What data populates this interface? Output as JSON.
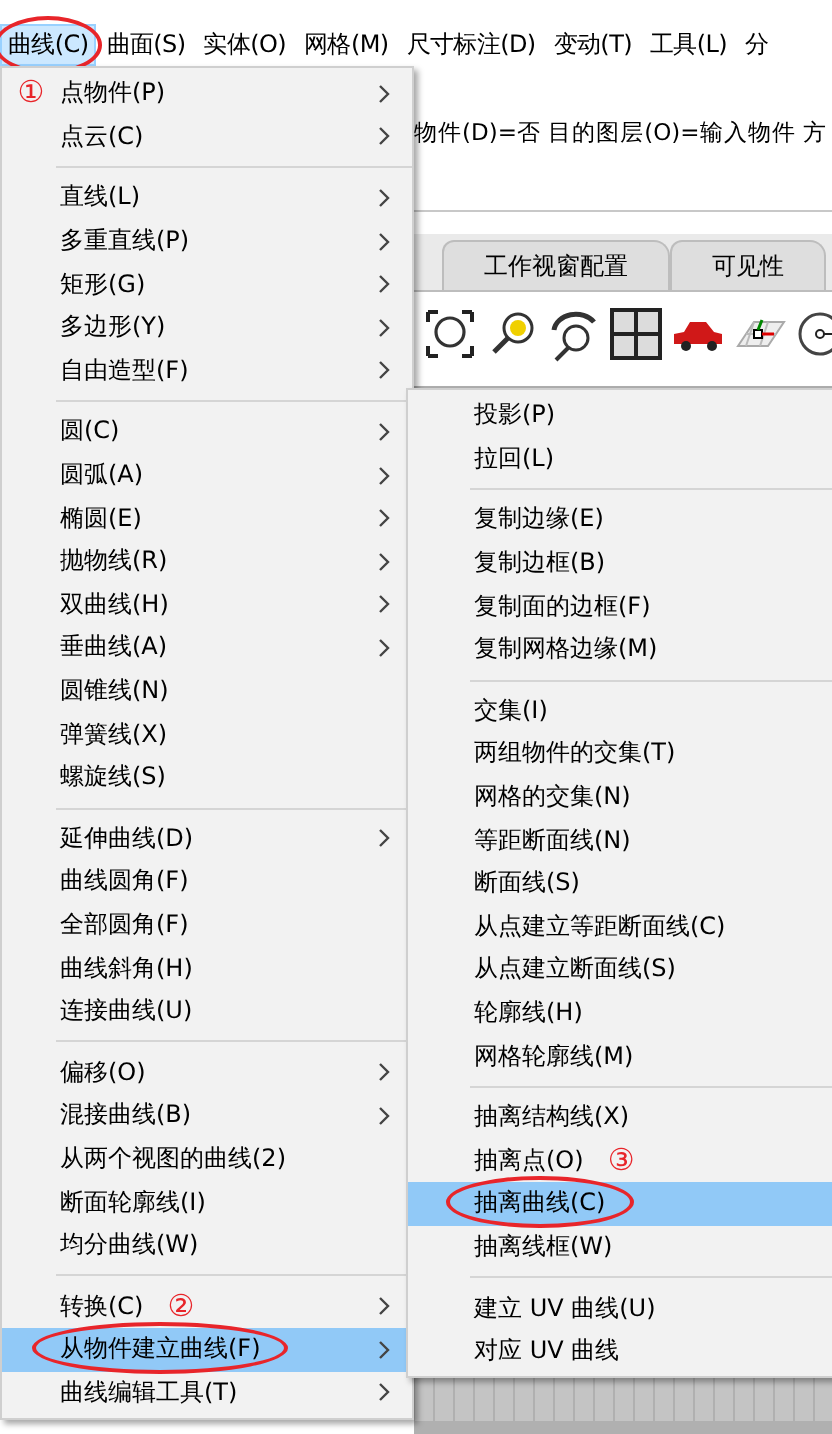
{
  "menubar": [
    {
      "label": "曲线(C)",
      "selected": true,
      "circled": true
    },
    {
      "label": "曲面(S)",
      "selected": false,
      "circled": false
    },
    {
      "label": "实体(O)",
      "selected": false,
      "circled": false
    },
    {
      "label": "网格(M)",
      "selected": false,
      "circled": false
    },
    {
      "label": "尺寸标注(D)",
      "selected": false,
      "circled": false
    },
    {
      "label": "变动(T)",
      "selected": false,
      "circled": false
    },
    {
      "label": "工具(L)",
      "selected": false,
      "circled": false
    },
    {
      "label": "分",
      "selected": false,
      "circled": false
    }
  ],
  "command_line": "物件(D)=否  目的图层(O)=输入物件  方",
  "tabs": [
    {
      "label": "工作视窗配置",
      "selected": false
    },
    {
      "label": "可见性",
      "selected": false
    }
  ],
  "menu": {
    "items": [
      {
        "kind": "item",
        "label": "点物件(P)",
        "submenu": true,
        "selected": false,
        "circled": false,
        "note": "①",
        "note_in_gutter": true
      },
      {
        "kind": "item",
        "label": "点云(C)",
        "submenu": true,
        "selected": false,
        "circled": false
      },
      {
        "kind": "separator"
      },
      {
        "kind": "item",
        "label": "直线(L)",
        "submenu": true,
        "selected": false,
        "circled": false
      },
      {
        "kind": "item",
        "label": "多重直线(P)",
        "submenu": true,
        "selected": false,
        "circled": false
      },
      {
        "kind": "item",
        "label": "矩形(G)",
        "submenu": true,
        "selected": false,
        "circled": false
      },
      {
        "kind": "item",
        "label": "多边形(Y)",
        "submenu": true,
        "selected": false,
        "circled": false
      },
      {
        "kind": "item",
        "label": "自由造型(F)",
        "submenu": true,
        "selected": false,
        "circled": false
      },
      {
        "kind": "separator"
      },
      {
        "kind": "item",
        "label": "圆(C)",
        "submenu": true,
        "selected": false,
        "circled": false
      },
      {
        "kind": "item",
        "label": "圆弧(A)",
        "submenu": true,
        "selected": false,
        "circled": false
      },
      {
        "kind": "item",
        "label": "椭圆(E)",
        "submenu": true,
        "selected": false,
        "circled": false
      },
      {
        "kind": "item",
        "label": "抛物线(R)",
        "submenu": true,
        "selected": false,
        "circled": false
      },
      {
        "kind": "item",
        "label": "双曲线(H)",
        "submenu": true,
        "selected": false,
        "circled": false
      },
      {
        "kind": "item",
        "label": "垂曲线(A)",
        "submenu": true,
        "selected": false,
        "circled": false
      },
      {
        "kind": "item",
        "label": "圆锥线(N)",
        "submenu": false,
        "selected": false,
        "circled": false
      },
      {
        "kind": "item",
        "label": "弹簧线(X)",
        "submenu": false,
        "selected": false,
        "circled": false
      },
      {
        "kind": "item",
        "label": "螺旋线(S)",
        "submenu": false,
        "selected": false,
        "circled": false
      },
      {
        "kind": "separator"
      },
      {
        "kind": "item",
        "label": "延伸曲线(D)",
        "submenu": true,
        "selected": false,
        "circled": false
      },
      {
        "kind": "item",
        "label": "曲线圆角(F)",
        "submenu": false,
        "selected": false,
        "circled": false
      },
      {
        "kind": "item",
        "label": "全部圆角(F)",
        "submenu": false,
        "selected": false,
        "circled": false
      },
      {
        "kind": "item",
        "label": "曲线斜角(H)",
        "submenu": false,
        "selected": false,
        "circled": false
      },
      {
        "kind": "item",
        "label": "连接曲线(U)",
        "submenu": false,
        "selected": false,
        "circled": false
      },
      {
        "kind": "separator"
      },
      {
        "kind": "item",
        "label": "偏移(O)",
        "submenu": true,
        "selected": false,
        "circled": false
      },
      {
        "kind": "item",
        "label": "混接曲线(B)",
        "submenu": true,
        "selected": false,
        "circled": false
      },
      {
        "kind": "item",
        "label": "从两个视图的曲线(2)",
        "submenu": false,
        "selected": false,
        "circled": false
      },
      {
        "kind": "item",
        "label": "断面轮廓线(I)",
        "submenu": false,
        "selected": false,
        "circled": false
      },
      {
        "kind": "item",
        "label": "均分曲线(W)",
        "submenu": false,
        "selected": false,
        "circled": false
      },
      {
        "kind": "separator"
      },
      {
        "kind": "item",
        "label": "转换(C)",
        "submenu": true,
        "selected": false,
        "circled": false,
        "note": "②",
        "note_in_gutter": false
      },
      {
        "kind": "item",
        "label": "从物件建立曲线(F)",
        "submenu": true,
        "selected": true,
        "circled": true
      },
      {
        "kind": "item",
        "label": "曲线编辑工具(T)",
        "submenu": true,
        "selected": false,
        "circled": false
      }
    ]
  },
  "submenu": {
    "items": [
      {
        "kind": "item",
        "label": "投影(P)",
        "submenu": false,
        "selected": false,
        "circled": false
      },
      {
        "kind": "item",
        "label": "拉回(L)",
        "submenu": false,
        "selected": false,
        "circled": false
      },
      {
        "kind": "separator"
      },
      {
        "kind": "item",
        "label": "复制边缘(E)",
        "submenu": false,
        "selected": false,
        "circled": false
      },
      {
        "kind": "item",
        "label": "复制边框(B)",
        "submenu": false,
        "selected": false,
        "circled": false
      },
      {
        "kind": "item",
        "label": "复制面的边框(F)",
        "submenu": false,
        "selected": false,
        "circled": false
      },
      {
        "kind": "item",
        "label": "复制网格边缘(M)",
        "submenu": false,
        "selected": false,
        "circled": false
      },
      {
        "kind": "separator"
      },
      {
        "kind": "item",
        "label": "交集(I)",
        "submenu": false,
        "selected": false,
        "circled": false
      },
      {
        "kind": "item",
        "label": "两组物件的交集(T)",
        "submenu": false,
        "selected": false,
        "circled": false
      },
      {
        "kind": "item",
        "label": "网格的交集(N)",
        "submenu": false,
        "selected": false,
        "circled": false
      },
      {
        "kind": "item",
        "label": "等距断面线(N)",
        "submenu": false,
        "selected": false,
        "circled": false
      },
      {
        "kind": "item",
        "label": "断面线(S)",
        "submenu": false,
        "selected": false,
        "circled": false
      },
      {
        "kind": "item",
        "label": "从点建立等距断面线(C)",
        "submenu": false,
        "selected": false,
        "circled": false
      },
      {
        "kind": "item",
        "label": "从点建立断面线(S)",
        "submenu": false,
        "selected": false,
        "circled": false
      },
      {
        "kind": "item",
        "label": "轮廓线(H)",
        "submenu": false,
        "selected": false,
        "circled": false
      },
      {
        "kind": "item",
        "label": "网格轮廓线(M)",
        "submenu": false,
        "selected": false,
        "circled": false
      },
      {
        "kind": "separator"
      },
      {
        "kind": "item",
        "label": "抽离结构线(X)",
        "submenu": false,
        "selected": false,
        "circled": false
      },
      {
        "kind": "item",
        "label": "抽离点(O)",
        "submenu": false,
        "selected": false,
        "circled": false,
        "note": "③",
        "note_in_gutter": false
      },
      {
        "kind": "item",
        "label": "抽离曲线(C)",
        "submenu": false,
        "selected": true,
        "circled": true
      },
      {
        "kind": "item",
        "label": "抽离线框(W)",
        "submenu": false,
        "selected": false,
        "circled": false
      },
      {
        "kind": "separator"
      },
      {
        "kind": "item",
        "label": "建立 UV 曲线(U)",
        "submenu": false,
        "selected": false,
        "circled": false
      },
      {
        "kind": "item",
        "label": "对应 UV 曲线",
        "submenu": false,
        "selected": false,
        "circled": false
      }
    ]
  }
}
